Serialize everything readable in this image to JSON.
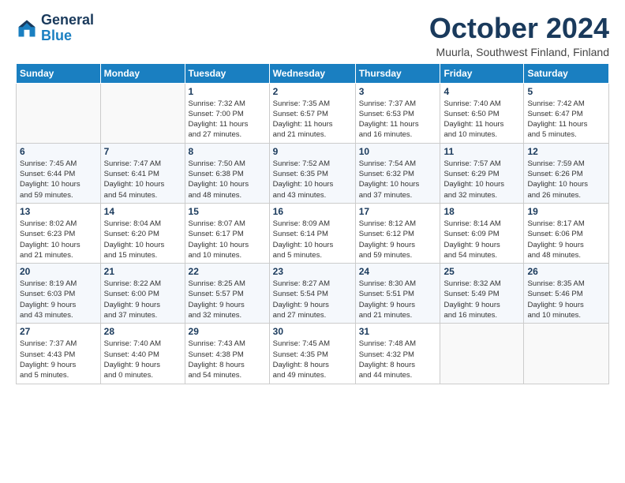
{
  "header": {
    "logo_line1": "General",
    "logo_line2": "Blue",
    "title": "October 2024",
    "subtitle": "Muurla, Southwest Finland, Finland"
  },
  "days_of_week": [
    "Sunday",
    "Monday",
    "Tuesday",
    "Wednesday",
    "Thursday",
    "Friday",
    "Saturday"
  ],
  "weeks": [
    [
      {
        "day": "",
        "info": ""
      },
      {
        "day": "",
        "info": ""
      },
      {
        "day": "1",
        "info": "Sunrise: 7:32 AM\nSunset: 7:00 PM\nDaylight: 11 hours\nand 27 minutes."
      },
      {
        "day": "2",
        "info": "Sunrise: 7:35 AM\nSunset: 6:57 PM\nDaylight: 11 hours\nand 21 minutes."
      },
      {
        "day": "3",
        "info": "Sunrise: 7:37 AM\nSunset: 6:53 PM\nDaylight: 11 hours\nand 16 minutes."
      },
      {
        "day": "4",
        "info": "Sunrise: 7:40 AM\nSunset: 6:50 PM\nDaylight: 11 hours\nand 10 minutes."
      },
      {
        "day": "5",
        "info": "Sunrise: 7:42 AM\nSunset: 6:47 PM\nDaylight: 11 hours\nand 5 minutes."
      }
    ],
    [
      {
        "day": "6",
        "info": "Sunrise: 7:45 AM\nSunset: 6:44 PM\nDaylight: 10 hours\nand 59 minutes."
      },
      {
        "day": "7",
        "info": "Sunrise: 7:47 AM\nSunset: 6:41 PM\nDaylight: 10 hours\nand 54 minutes."
      },
      {
        "day": "8",
        "info": "Sunrise: 7:50 AM\nSunset: 6:38 PM\nDaylight: 10 hours\nand 48 minutes."
      },
      {
        "day": "9",
        "info": "Sunrise: 7:52 AM\nSunset: 6:35 PM\nDaylight: 10 hours\nand 43 minutes."
      },
      {
        "day": "10",
        "info": "Sunrise: 7:54 AM\nSunset: 6:32 PM\nDaylight: 10 hours\nand 37 minutes."
      },
      {
        "day": "11",
        "info": "Sunrise: 7:57 AM\nSunset: 6:29 PM\nDaylight: 10 hours\nand 32 minutes."
      },
      {
        "day": "12",
        "info": "Sunrise: 7:59 AM\nSunset: 6:26 PM\nDaylight: 10 hours\nand 26 minutes."
      }
    ],
    [
      {
        "day": "13",
        "info": "Sunrise: 8:02 AM\nSunset: 6:23 PM\nDaylight: 10 hours\nand 21 minutes."
      },
      {
        "day": "14",
        "info": "Sunrise: 8:04 AM\nSunset: 6:20 PM\nDaylight: 10 hours\nand 15 minutes."
      },
      {
        "day": "15",
        "info": "Sunrise: 8:07 AM\nSunset: 6:17 PM\nDaylight: 10 hours\nand 10 minutes."
      },
      {
        "day": "16",
        "info": "Sunrise: 8:09 AM\nSunset: 6:14 PM\nDaylight: 10 hours\nand 5 minutes."
      },
      {
        "day": "17",
        "info": "Sunrise: 8:12 AM\nSunset: 6:12 PM\nDaylight: 9 hours\nand 59 minutes."
      },
      {
        "day": "18",
        "info": "Sunrise: 8:14 AM\nSunset: 6:09 PM\nDaylight: 9 hours\nand 54 minutes."
      },
      {
        "day": "19",
        "info": "Sunrise: 8:17 AM\nSunset: 6:06 PM\nDaylight: 9 hours\nand 48 minutes."
      }
    ],
    [
      {
        "day": "20",
        "info": "Sunrise: 8:19 AM\nSunset: 6:03 PM\nDaylight: 9 hours\nand 43 minutes."
      },
      {
        "day": "21",
        "info": "Sunrise: 8:22 AM\nSunset: 6:00 PM\nDaylight: 9 hours\nand 37 minutes."
      },
      {
        "day": "22",
        "info": "Sunrise: 8:25 AM\nSunset: 5:57 PM\nDaylight: 9 hours\nand 32 minutes."
      },
      {
        "day": "23",
        "info": "Sunrise: 8:27 AM\nSunset: 5:54 PM\nDaylight: 9 hours\nand 27 minutes."
      },
      {
        "day": "24",
        "info": "Sunrise: 8:30 AM\nSunset: 5:51 PM\nDaylight: 9 hours\nand 21 minutes."
      },
      {
        "day": "25",
        "info": "Sunrise: 8:32 AM\nSunset: 5:49 PM\nDaylight: 9 hours\nand 16 minutes."
      },
      {
        "day": "26",
        "info": "Sunrise: 8:35 AM\nSunset: 5:46 PM\nDaylight: 9 hours\nand 10 minutes."
      }
    ],
    [
      {
        "day": "27",
        "info": "Sunrise: 7:37 AM\nSunset: 4:43 PM\nDaylight: 9 hours\nand 5 minutes."
      },
      {
        "day": "28",
        "info": "Sunrise: 7:40 AM\nSunset: 4:40 PM\nDaylight: 9 hours\nand 0 minutes."
      },
      {
        "day": "29",
        "info": "Sunrise: 7:43 AM\nSunset: 4:38 PM\nDaylight: 8 hours\nand 54 minutes."
      },
      {
        "day": "30",
        "info": "Sunrise: 7:45 AM\nSunset: 4:35 PM\nDaylight: 8 hours\nand 49 minutes."
      },
      {
        "day": "31",
        "info": "Sunrise: 7:48 AM\nSunset: 4:32 PM\nDaylight: 8 hours\nand 44 minutes."
      },
      {
        "day": "",
        "info": ""
      },
      {
        "day": "",
        "info": ""
      }
    ]
  ]
}
